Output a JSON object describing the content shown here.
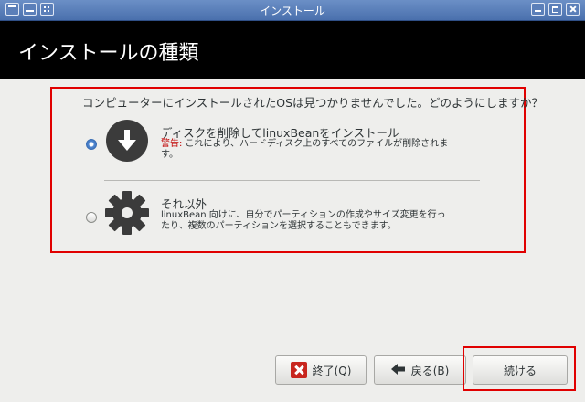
{
  "window": {
    "title": "インストール"
  },
  "header": {
    "title": "インストールの種類"
  },
  "question": "コンピューターにインストールされたOSは見つかりませんでした。どのようにしますか？",
  "options": [
    {
      "title": "ディスクを削除してlinuxBeanをインストール",
      "warning_label": "警告:",
      "description": " これにより、ハードディスク上のすべてのファイルが削除されます。",
      "selected": true,
      "icon": "download-arrow-icon"
    },
    {
      "title": "それ以外",
      "description": "linuxBean 向けに、自分でパーティションの作成やサイズ変更を行ったり、複数のパーティションを選択することもできます。",
      "selected": false,
      "icon": "gear-icon"
    }
  ],
  "buttons": {
    "quit": "終了(Q)",
    "back": "戻る(B)",
    "continue": "続ける"
  },
  "colors": {
    "highlight": "#e00000",
    "header_bg": "#000000",
    "warning": "#c00000"
  }
}
